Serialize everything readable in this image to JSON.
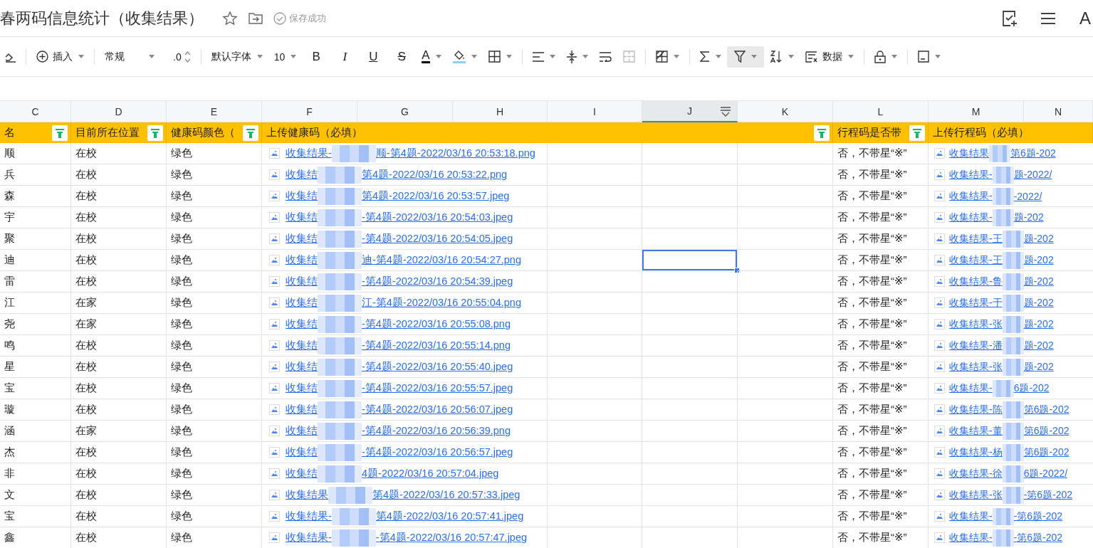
{
  "title_bar": {
    "title": "春两码信息统计（收集结果）",
    "save_status": "保存成功",
    "font_button": "A"
  },
  "toolbar": {
    "insert": "插入",
    "number_format": "常规",
    "decimal": ".0",
    "font": "默认字体",
    "font_size": "10",
    "bold": "B",
    "italic": "I",
    "underline": "U",
    "strikethrough": "S",
    "text_color": "A",
    "data": "数据",
    "filter_active": true,
    "merge_disabled": true
  },
  "columns": [
    {
      "letter": "C",
      "selected": false
    },
    {
      "letter": "D",
      "selected": false
    },
    {
      "letter": "E",
      "selected": false
    },
    {
      "letter": "F",
      "selected": false
    },
    {
      "letter": "G",
      "selected": false
    },
    {
      "letter": "H",
      "selected": false
    },
    {
      "letter": "I",
      "selected": false
    },
    {
      "letter": "J",
      "selected": true
    },
    {
      "letter": "K",
      "selected": false
    },
    {
      "letter": "L",
      "selected": false
    },
    {
      "letter": "M",
      "selected": false
    },
    {
      "letter": "N",
      "selected": false
    }
  ],
  "header_cells": [
    {
      "text": "名",
      "filter": true
    },
    {
      "text": "目前所在位置",
      "filter": true
    },
    {
      "text": "健康码颜色（",
      "filter": true
    },
    {
      "text": "上传健康码（必填）",
      "filter": true
    },
    {
      "text": "行程码是否带",
      "filter": true
    },
    {
      "text": "上传行程码（必填）",
      "filter": false
    }
  ],
  "rows": [
    {
      "c": "顺",
      "d": "在校",
      "e": "绿色",
      "health_link": {
        "before": "收集结果-",
        "after": "顺-第4题-2022/03/16 20:53:18.png"
      },
      "l": "否，不带星“※”",
      "trip_link": {
        "before": "收集结果",
        "after": "第6题-202"
      },
      "selected": false
    },
    {
      "c": "兵",
      "d": "在校",
      "e": "绿色",
      "health_link": {
        "before": "收集结",
        "after": "第4题-2022/03/16 20:53:22.png"
      },
      "l": "否，不带星“※”",
      "trip_link": {
        "before": "收集结果-",
        "after": "题-2022/"
      },
      "selected": false
    },
    {
      "c": "森",
      "d": "在校",
      "e": "绿色",
      "health_link": {
        "before": "收集结",
        "after": "第4题-2022/03/16 20:53:57.jpeg"
      },
      "l": "否，不带星“※”",
      "trip_link": {
        "before": "收集结果-",
        "after": "-2022/"
      },
      "selected": false
    },
    {
      "c": "宇",
      "d": "在校",
      "e": "绿色",
      "health_link": {
        "before": "收集结",
        "after": "-第4题-2022/03/16 20:54:03.jpeg"
      },
      "l": "否，不带星“※”",
      "trip_link": {
        "before": "收集结果-",
        "after": "题-202"
      },
      "selected": false
    },
    {
      "c": "聚",
      "d": "在校",
      "e": "绿色",
      "health_link": {
        "before": "收集结",
        "after": "-第4题-2022/03/16 20:54:05.jpeg"
      },
      "l": "否，不带星“※”",
      "trip_link": {
        "before": "收集结果-王",
        "after": "题-202"
      },
      "selected": false
    },
    {
      "c": "迪",
      "d": "在校",
      "e": "绿色",
      "health_link": {
        "before": "收集结",
        "after": "迪-第4题-2022/03/16 20:54:27.png"
      },
      "l": "否，不带星“※”",
      "trip_link": {
        "before": "收集结果-王",
        "after": "题-202"
      },
      "selected": true
    },
    {
      "c": "雷",
      "d": "在校",
      "e": "绿色",
      "health_link": {
        "before": "收集结",
        "after": "-第4题-2022/03/16 20:54:39.jpeg"
      },
      "l": "否，不带星“※”",
      "trip_link": {
        "before": "收集结果-鲁",
        "after": "题-202"
      },
      "selected": false
    },
    {
      "c": "江",
      "d": "在家",
      "e": "绿色",
      "health_link": {
        "before": "收集结",
        "after": "江-第4题-2022/03/16 20:55:04.png"
      },
      "l": "否，不带星“※”",
      "trip_link": {
        "before": "收集结果-于",
        "after": "题-202"
      },
      "selected": false
    },
    {
      "c": "尧",
      "d": "在家",
      "e": "绿色",
      "health_link": {
        "before": "收集结",
        "after": "-第4题-2022/03/16 20:55:08.png"
      },
      "l": "否，不带星“※”",
      "trip_link": {
        "before": "收集结果-张",
        "after": "题-202"
      },
      "selected": false
    },
    {
      "c": "鸣",
      "d": "在校",
      "e": "绿色",
      "health_link": {
        "before": "收集结",
        "after": "-第4题-2022/03/16 20:55:14.png"
      },
      "l": "否，不带星“※”",
      "trip_link": {
        "before": "收集结果-潘",
        "after": "题-202"
      },
      "selected": false
    },
    {
      "c": "星",
      "d": "在校",
      "e": "绿色",
      "health_link": {
        "before": "收集结",
        "after": "-第4题-2022/03/16 20:55:40.jpeg"
      },
      "l": "否，不带星“※”",
      "trip_link": {
        "before": "收集结果-张",
        "after": "题-202"
      },
      "selected": false
    },
    {
      "c": "宝",
      "d": "在校",
      "e": "绿色",
      "health_link": {
        "before": "收集结",
        "after": "-第4题-2022/03/16 20:55:57.jpeg"
      },
      "l": "否，不带星“※”",
      "trip_link": {
        "before": "收集结果-",
        "after": "6题-202"
      },
      "selected": false
    },
    {
      "c": "璇",
      "d": "在校",
      "e": "绿色",
      "health_link": {
        "before": "收集结",
        "after": "-第4题-2022/03/16 20:56:07.jpeg"
      },
      "l": "否，不带星“※”",
      "trip_link": {
        "before": "收集结果-陈",
        "after": "第6题-202"
      },
      "selected": false
    },
    {
      "c": "涵",
      "d": "在家",
      "e": "绿色",
      "health_link": {
        "before": "收集结",
        "after": "-第4题-2022/03/16 20:56:39.png"
      },
      "l": "否，不带星“※”",
      "trip_link": {
        "before": "收集结果-董",
        "after": "第6题-202"
      },
      "selected": false
    },
    {
      "c": "杰",
      "d": "在校",
      "e": "绿色",
      "health_link": {
        "before": "收集结",
        "after": "-第4题-2022/03/16 20:56:57.jpeg"
      },
      "l": "否，不带星“※”",
      "trip_link": {
        "before": "收集结果-杨",
        "after": "第6题-202"
      },
      "selected": false
    },
    {
      "c": "非",
      "d": "在校",
      "e": "绿色",
      "health_link": {
        "before": "收集结",
        "after": "4题-2022/03/16 20:57:04.jpeg"
      },
      "l": "否，不带星“※”",
      "trip_link": {
        "before": "收集结果-徐",
        "after": "6题-2022/"
      },
      "selected": false
    },
    {
      "c": "文",
      "d": "在校",
      "e": "绿色",
      "health_link": {
        "before": "收集结果",
        "after": "第4题-2022/03/16 20:57:33.jpeg"
      },
      "l": "否，不带星“※”",
      "trip_link": {
        "before": "收集结果-张",
        "after": "-第6题-202"
      },
      "selected": false
    },
    {
      "c": "宝",
      "d": "在校",
      "e": "绿色",
      "health_link": {
        "before": "收集结果-",
        "after": "第4题-2022/03/16 20:57:41.jpeg"
      },
      "l": "否，不带星“※”",
      "trip_link": {
        "before": "收集结果-",
        "after": "-第6题-202"
      },
      "selected": false
    },
    {
      "c": "鑫",
      "d": "在校",
      "e": "绿色",
      "health_link": {
        "before": "收集结果-",
        "after": "-第4题-2022/03/16 20:57:47.jpeg"
      },
      "l": "否，不带星“※”",
      "trip_link": {
        "before": "收集结果-",
        "after": "-第6题-202"
      },
      "selected": false
    }
  ]
}
